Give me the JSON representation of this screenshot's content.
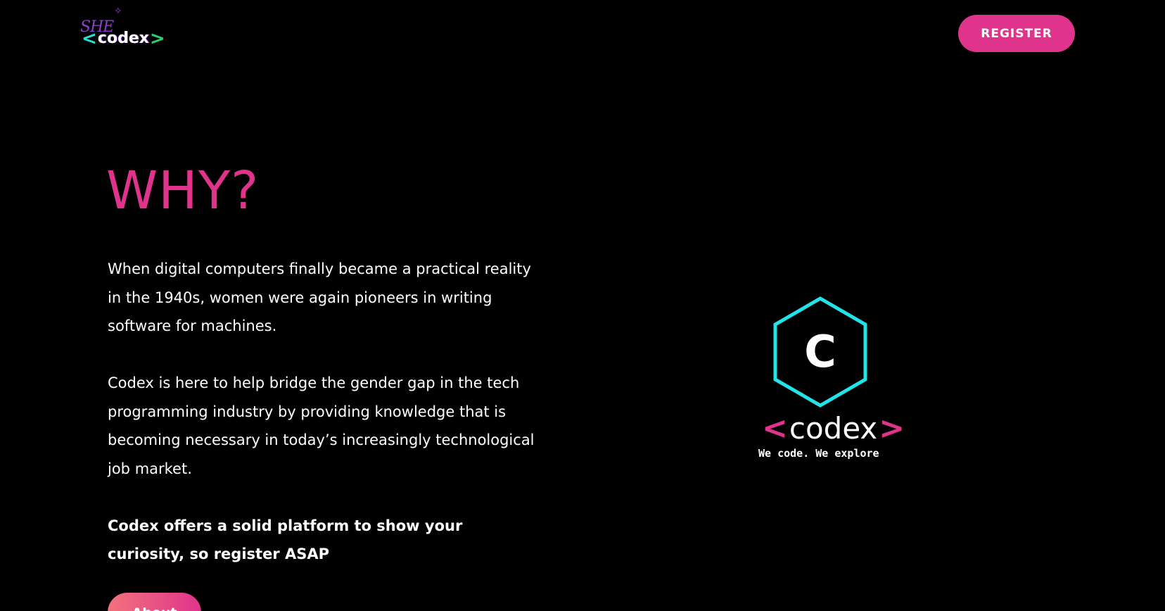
{
  "header": {
    "logo": {
      "script_text": "SHE",
      "lt": "<",
      "word": "codex",
      "gt": ">"
    },
    "register_label": "REGISTER"
  },
  "main": {
    "title": "WHY?",
    "paragraphs": [
      "When digital computers finally became a practical reality in the 1940s, women were again pioneers in writing software for machines.",
      "Codex is here to help bridge the gender gap in the tech programming industry by providing knowledge that is becoming necessary in today’s increasingly technological job market."
    ],
    "highlight": "Codex offers a solid platform to show your curiosity, so register ASAP",
    "about_label": "About"
  },
  "logo_panel": {
    "icon_letter": "C",
    "lt": "<",
    "word": "codex",
    "gt": ">",
    "tagline": "We code. We explore"
  },
  "colors": {
    "background": "#000000",
    "accent_pink": "#e0348c",
    "accent_cyan": "#22e3e8",
    "text": "#ffffff"
  },
  "icons": [
    "codex-hexagon-icon"
  ]
}
